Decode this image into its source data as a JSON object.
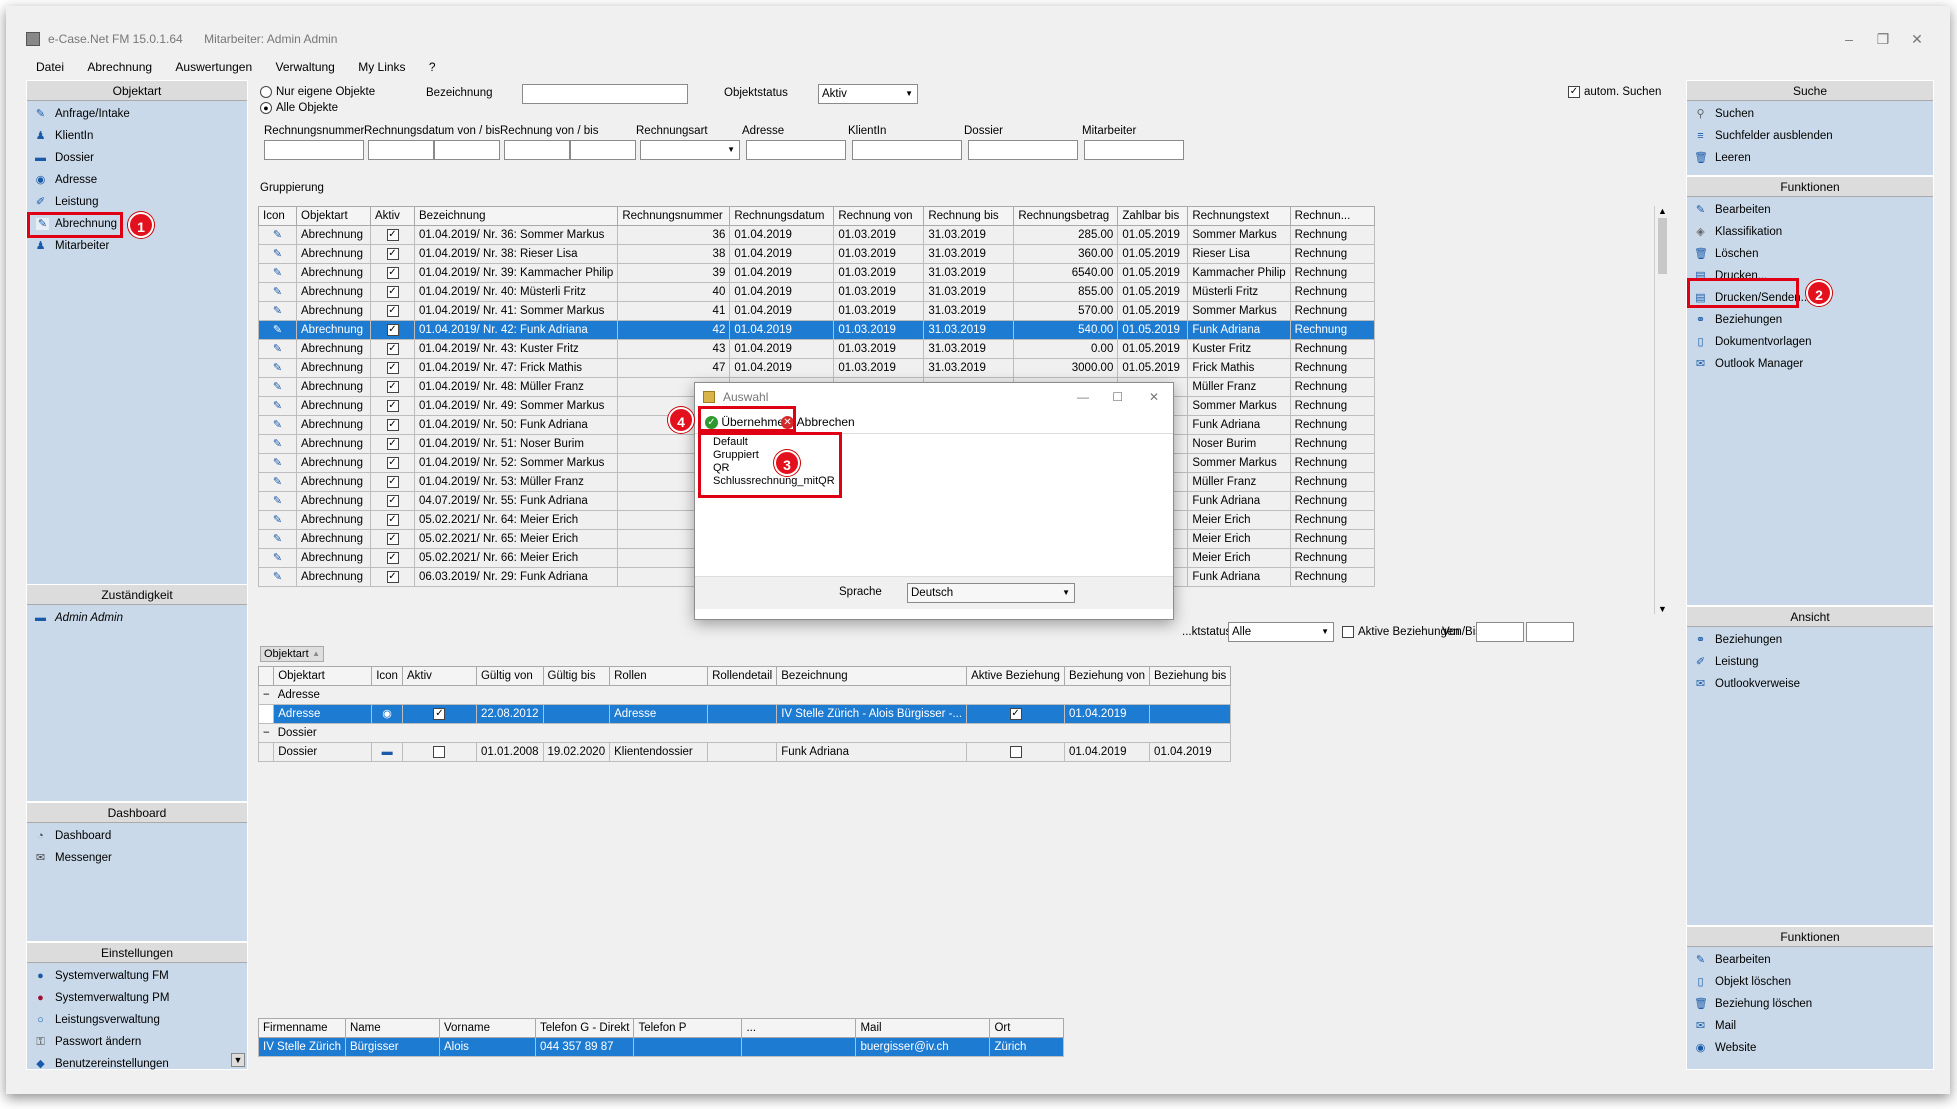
{
  "window": {
    "title": "e-Case.Net FM 15.0.1.64",
    "user": "Mitarbeiter: Admin Admin"
  },
  "menu": [
    "Datei",
    "Abrechnung",
    "Auswertungen",
    "Verwaltung",
    "My Links",
    "?"
  ],
  "left": {
    "objektart": {
      "title": "Objektart",
      "items": [
        "Anfrage/Intake",
        "KlientIn",
        "Dossier",
        "Adresse",
        "Leistung",
        "Abrechnung",
        "Mitarbeiter"
      ]
    },
    "zustaendigkeit": {
      "title": "Zuständigkeit",
      "items": [
        "Admin Admin"
      ]
    },
    "dashboard": {
      "title": "Dashboard",
      "items": [
        "Dashboard",
        "Messenger"
      ]
    },
    "einstellungen": {
      "title": "Einstellungen",
      "items": [
        "Systemverwaltung FM",
        "Systemverwaltung PM",
        "Leistungsverwaltung",
        "Passwort ändern",
        "Benutzereinstellungen"
      ]
    }
  },
  "filters": {
    "radio_own": "Nur eigene Objekte",
    "radio_all": "Alle Objekte",
    "bezeichnung_label": "Bezeichnung",
    "objektstatus_label": "Objektstatus",
    "objektstatus_value": "Aktiv",
    "auto_search": "autom. Suchen",
    "labels": [
      "Rechnungsnummer",
      "Rechnungsdatum von / bis",
      "Rechnung von / bis",
      "Rechnungsart",
      "Adresse",
      "KlientIn",
      "Dossier",
      "Mitarbeiter"
    ],
    "gruppierung": "Gruppierung"
  },
  "main_table": {
    "headers": [
      "Icon",
      "Objektart",
      "Aktiv",
      "Bezeichnung",
      "Rechnungsnummer",
      "Rechnungsdatum",
      "Rechnung von",
      "Rechnung bis",
      "Rechnungsbetrag",
      "Zahlbar bis",
      "Rechnungstext",
      "Rechnun..."
    ],
    "rows": [
      [
        "Abrechnung",
        "01.04.2019/ Nr. 36: Sommer Markus",
        "36",
        "01.04.2019",
        "01.03.2019",
        "31.03.2019",
        "285.00",
        "01.05.2019",
        "Sommer Markus",
        "Rechnung"
      ],
      [
        "Abrechnung",
        "01.04.2019/ Nr. 38: Rieser Lisa",
        "38",
        "01.04.2019",
        "01.03.2019",
        "31.03.2019",
        "360.00",
        "01.05.2019",
        "Rieser Lisa",
        "Rechnung"
      ],
      [
        "Abrechnung",
        "01.04.2019/ Nr. 39: Kammacher Philip",
        "39",
        "01.04.2019",
        "01.03.2019",
        "31.03.2019",
        "6540.00",
        "01.05.2019",
        "Kammacher Philip",
        "Rechnung"
      ],
      [
        "Abrechnung",
        "01.04.2019/ Nr. 40: Müsterli Fritz",
        "40",
        "01.04.2019",
        "01.03.2019",
        "31.03.2019",
        "855.00",
        "01.05.2019",
        "Müsterli Fritz",
        "Rechnung"
      ],
      [
        "Abrechnung",
        "01.04.2019/ Nr. 41: Sommer Markus",
        "41",
        "01.04.2019",
        "01.03.2019",
        "31.03.2019",
        "570.00",
        "01.05.2019",
        "Sommer Markus",
        "Rechnung"
      ],
      [
        "Abrechnung",
        "01.04.2019/ Nr. 42: Funk Adriana",
        "42",
        "01.04.2019",
        "01.03.2019",
        "31.03.2019",
        "540.00",
        "01.05.2019",
        "Funk Adriana",
        "Rechnung"
      ],
      [
        "Abrechnung",
        "01.04.2019/ Nr. 43: Kuster Fritz",
        "43",
        "01.04.2019",
        "01.03.2019",
        "31.03.2019",
        "0.00",
        "01.05.2019",
        "Kuster Fritz",
        "Rechnung"
      ],
      [
        "Abrechnung",
        "01.04.2019/ Nr. 47: Frick Mathis",
        "47",
        "01.04.2019",
        "01.03.2019",
        "31.03.2019",
        "3000.00",
        "01.05.2019",
        "Frick Mathis",
        "Rechnung"
      ],
      [
        "Abrechnung",
        "01.04.2019/ Nr. 48: Müller Franz",
        "",
        "",
        "",
        "",
        "",
        "",
        "Müller Franz",
        "Rechnung"
      ],
      [
        "Abrechnung",
        "01.04.2019/ Nr. 49: Sommer Markus",
        "",
        "",
        "",
        "",
        "",
        "",
        "Sommer Markus",
        "Rechnung"
      ],
      [
        "Abrechnung",
        "01.04.2019/ Nr. 50: Funk Adriana",
        "",
        "",
        "",
        "",
        "",
        "",
        "Funk Adriana",
        "Rechnung"
      ],
      [
        "Abrechnung",
        "01.04.2019/ Nr. 51: Noser Burim",
        "",
        "",
        "",
        "",
        "",
        "",
        "Noser Burim",
        "Rechnung"
      ],
      [
        "Abrechnung",
        "01.04.2019/ Nr. 52: Sommer Markus",
        "",
        "",
        "",
        "",
        "",
        "",
        "Sommer Markus",
        "Rechnung"
      ],
      [
        "Abrechnung",
        "01.04.2019/ Nr. 53: Müller Franz",
        "",
        "",
        "",
        "",
        "",
        "",
        "Müller Franz",
        "Rechnung"
      ],
      [
        "Abrechnung",
        "04.07.2019/ Nr. 55: Funk Adriana",
        "",
        "",
        "",
        "",
        "",
        "",
        "Funk Adriana",
        "Rechnung"
      ],
      [
        "Abrechnung",
        "05.02.2021/ Nr. 64: Meier Erich",
        "",
        "",
        "",
        "",
        "",
        "",
        "Meier Erich",
        "Rechnung"
      ],
      [
        "Abrechnung",
        "05.02.2021/ Nr. 65: Meier Erich",
        "",
        "",
        "",
        "",
        "",
        "",
        "Meier Erich",
        "Rechnung"
      ],
      [
        "Abrechnung",
        "05.02.2021/ Nr. 66: Meier Erich",
        "",
        "",
        "",
        "",
        "",
        "",
        "Meier Erich",
        "Rechnung"
      ],
      [
        "Abrechnung",
        "06.03.2019/ Nr. 29: Funk Adriana",
        "",
        "",
        "",
        "",
        "",
        "",
        "Funk Adriana",
        "Rechnung"
      ]
    ],
    "selected_index": 5
  },
  "relations": {
    "status_label": "...ktstatus",
    "status_value": "Alle",
    "aktive_beziehungen": "Aktive Beziehungen",
    "von_bis": "Von/Bis",
    "group_header": "Objektart",
    "headers": [
      "Objektart",
      "Icon",
      "Aktiv",
      "Gültig von",
      "Gültig bis",
      "Rollen",
      "Rollendetail",
      "Bezeichnung",
      "Aktive Beziehung",
      "Beziehung von",
      "Beziehung bis"
    ],
    "groups": [
      {
        "name": "Adresse",
        "row": [
          "Adresse",
          "",
          "x",
          "22.08.2012",
          "",
          "Adresse",
          "",
          "IV Stelle Zürich - Alois Bürgisser -...",
          "x",
          "01.04.2019",
          ""
        ]
      },
      {
        "name": "Dossier",
        "row": [
          "Dossier",
          "",
          "",
          "01.01.2008",
          "19.02.2020",
          "Klientendossier",
          "",
          "Funk Adriana",
          "",
          "01.04.2019",
          "01.04.2019"
        ]
      }
    ]
  },
  "contacts": {
    "headers": [
      "Firmenname",
      "Name",
      "Vorname",
      "Telefon G - Direkt",
      "Telefon P",
      "...",
      "Mail",
      "Ort"
    ],
    "row": [
      "IV Stelle Zürich",
      "Bürgisser",
      "Alois",
      "044 357 89 87",
      "",
      "",
      "buergisser@iv.ch",
      "Zürich"
    ]
  },
  "right": {
    "suche": {
      "title": "Suche",
      "items": [
        "Suchen",
        "Suchfelder ausblenden",
        "Leeren"
      ]
    },
    "funktionen": {
      "title": "Funktionen",
      "items": [
        "Bearbeiten",
        "Klassifikation",
        "Löschen",
        "Drucken...",
        "Drucken/Senden...",
        "Beziehungen",
        "Dokumentvorlagen",
        "Outlook Manager"
      ]
    },
    "ansicht": {
      "title": "Ansicht",
      "items": [
        "Beziehungen",
        "Leistung",
        "Outlookverweise"
      ]
    },
    "funktionen2": {
      "title": "Funktionen",
      "items": [
        "Bearbeiten",
        "Objekt löschen",
        "Beziehung löschen",
        "Mail",
        "Website"
      ]
    }
  },
  "dialog": {
    "title": "Auswahl",
    "ok": "Übernehmen",
    "cancel": "Abbrechen",
    "items": [
      "Default",
      "Gruppiert",
      "QR",
      "Schlussrechnung_mitQR"
    ],
    "sprache_label": "Sprache",
    "sprache_value": "Deutsch"
  },
  "badges": [
    "1",
    "2",
    "3",
    "4"
  ],
  "colors": {
    "accent": "#1e7bd2",
    "highlight": "#e00014",
    "panel": "#c9d9e9"
  }
}
